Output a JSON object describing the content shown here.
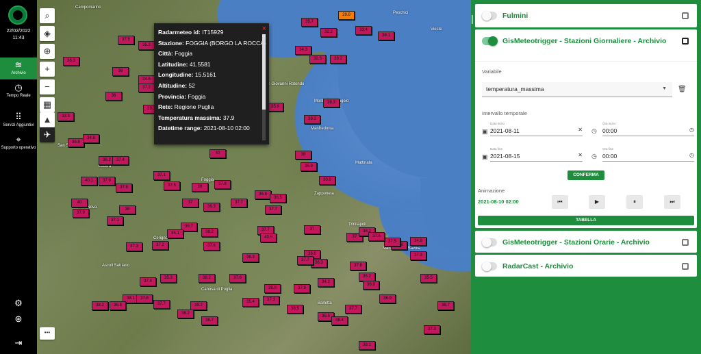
{
  "sidebar": {
    "date": "22/02/2022",
    "time": "11:43",
    "items": [
      {
        "label": "Archivio",
        "icon": "layers-icon",
        "glyph": "≋"
      },
      {
        "label": "Tempo Reale",
        "icon": "clock-icon",
        "glyph": "◷"
      },
      {
        "label": "Servizi Aggiuntivi",
        "icon": "grid-icon",
        "glyph": "⠿"
      },
      {
        "label": "Supporto operativo",
        "icon": "crosshair-icon",
        "glyph": "⌖"
      }
    ],
    "bottom_icons": [
      "settings-icon",
      "help-lifebuoy-icon",
      "logout-icon"
    ]
  },
  "map": {
    "controls": [
      {
        "name": "search",
        "glyph": "⌕"
      },
      {
        "name": "layers",
        "glyph": "◈"
      },
      {
        "name": "locate",
        "glyph": "⊕"
      },
      {
        "name": "zoom-in",
        "glyph": "+"
      },
      {
        "name": "zoom-out",
        "glyph": "−"
      },
      {
        "name": "map-view",
        "glyph": "▦"
      },
      {
        "name": "terrain",
        "glyph": "▲"
      },
      {
        "name": "satellite",
        "glyph": "✈"
      }
    ],
    "more_button": "•••",
    "markers": [
      "29.8",
      "35.7",
      "32.2",
      "33.4",
      "38.1",
      "37.5",
      "34.3",
      "32.6",
      "39.2",
      "35.2",
      "36",
      "36.3",
      "34.6",
      "36",
      "37.2",
      "35.8",
      "38.3",
      "33.3",
      "39.1",
      "32.3",
      "39.2",
      "36.8",
      "34.8",
      "36.2",
      "37.4",
      "40.1",
      "37.9",
      "37.8",
      "40",
      "38",
      "37.9",
      "37.1",
      "37.1",
      "37.5",
      "39",
      "37.8",
      "37.7",
      "37",
      "36.3",
      "35.8",
      "36.5",
      "38",
      "30.9",
      "36.9",
      "40",
      "37.7",
      "37.7",
      "37",
      "37",
      "38.2",
      "36.8",
      "34.8",
      "37.5",
      "37.3",
      "37.2",
      "36.7",
      "38.2",
      "35.1",
      "37.6",
      "40.5",
      "36.8",
      "36.3",
      "37.6",
      "36.3",
      "37.7",
      "37.8",
      "37.3",
      "35.5",
      "35.2",
      "36.9",
      "34.2",
      "35.8",
      "37.6",
      "38.2",
      "39.2",
      "38.2",
      "35.3",
      "37.4",
      "38.1",
      "38.2",
      "36.8",
      "37.8",
      "37.7",
      "36.7",
      "35.4",
      "37.3",
      "38.5",
      "35.5",
      "38.4",
      "37.7",
      "37.9",
      "36.9",
      "38.7",
      "37.3",
      "38.1"
    ],
    "places": [
      "Campomarino",
      "San Severo",
      "Manfredonia",
      "Peschici",
      "Lucera",
      "Foggia",
      "Orta Nova",
      "Cerignola",
      "Trinitapoli",
      "Margherita di Savoia",
      "Zapponeta",
      "Vieste",
      "Mattinata",
      "Monte Sant'Angelo",
      "San Giovanni Rotondo",
      "Ascoli Satriano",
      "Canosa di Puglia",
      "Barletta"
    ]
  },
  "tooltip": {
    "rows": [
      {
        "key": "Radarmeteo id",
        "value": "IT15929"
      },
      {
        "key": "Stazione",
        "value": "FOGGIA (BORGO LA ROCCA)"
      },
      {
        "key": "Città",
        "value": "Foggia"
      },
      {
        "key": "Latitudine",
        "value": "41.5581"
      },
      {
        "key": "Longitudine",
        "value": "15.5161"
      },
      {
        "key": "Altitudine",
        "value": "52"
      },
      {
        "key": "Provincia",
        "value": "Foggia"
      },
      {
        "key": "Rete",
        "value": "Regione Puglia"
      },
      {
        "key": "Temperatura massima",
        "value": "37.9"
      },
      {
        "key": "Datetime range",
        "value": "2021-08-10 02:00"
      }
    ],
    "close": "×"
  },
  "panel": {
    "collapse": "→|",
    "cards": [
      {
        "title": "Fulmini",
        "enabled": false
      },
      {
        "title": "GisMeteotrigger - Stazioni Giornaliere - Archivio",
        "enabled": true
      },
      {
        "title": "GisMeteotrigger - Stazioni Orarie - Archivio",
        "enabled": false
      },
      {
        "title": "RadarCast - Archivio",
        "enabled": false
      }
    ],
    "form": {
      "variable_label": "Variabile",
      "variable_value": "temperatura_massima",
      "interval_label": "Intervallo temporale",
      "start_date_label": "Data inizio",
      "start_date": "2021-08-11",
      "start_time_label": "Ora inizio",
      "start_time": "00:00",
      "end_date_label": "Data fine",
      "end_date": "2021-08-15",
      "end_time_label": "Ora fine",
      "end_time": "00:00",
      "confirm": "CONFERMA",
      "animation_label": "Animazione",
      "animation_time": "2021-08-10 02:00",
      "table": "TABELLA"
    }
  }
}
